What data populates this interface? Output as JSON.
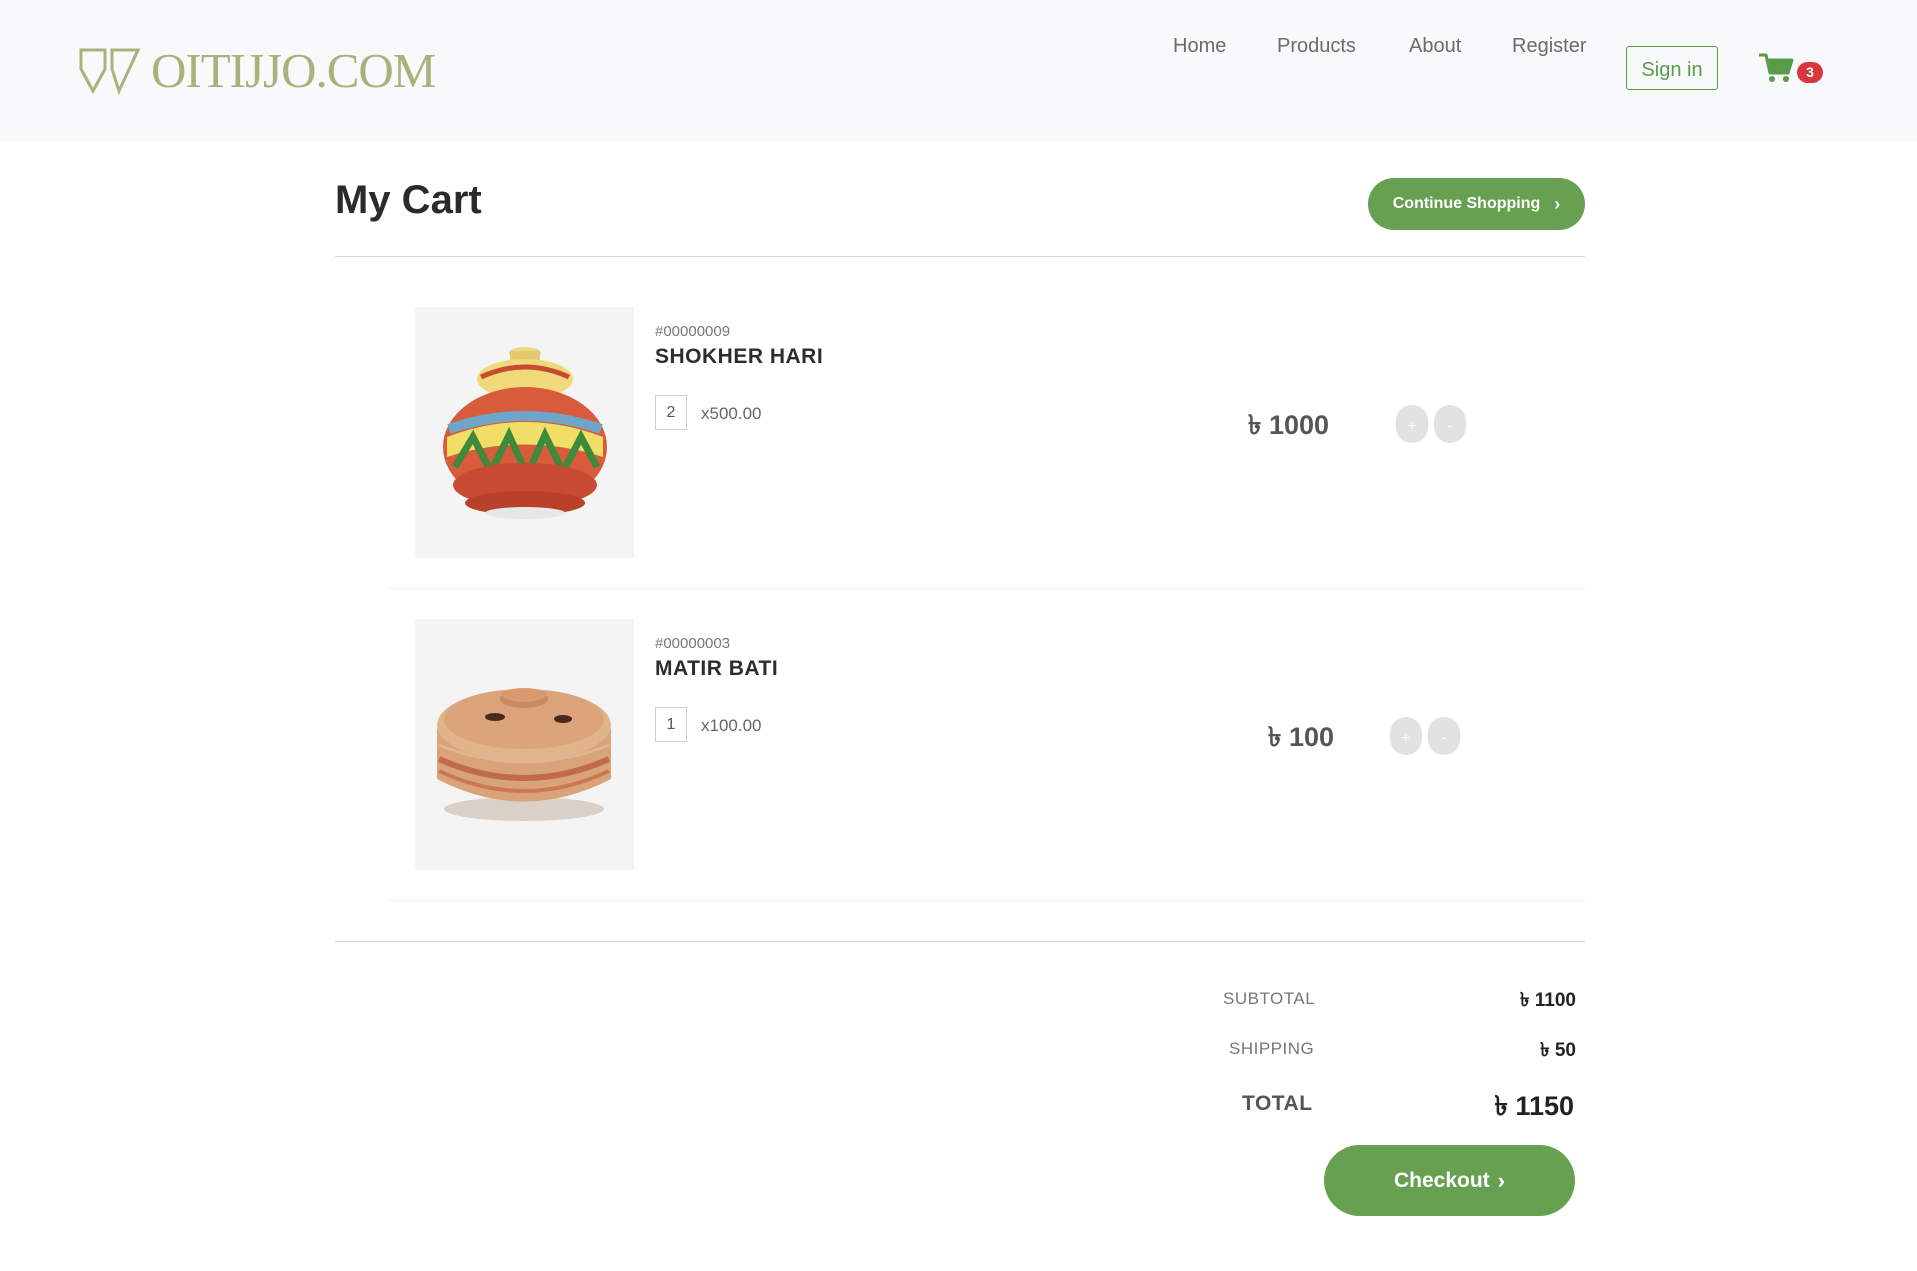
{
  "brand": {
    "name": "OITIJJO.COM",
    "logo_icon": "shield-mark-icon"
  },
  "nav": {
    "links": [
      "Home",
      "Products",
      "About",
      "Register"
    ],
    "signin_label": "Sign in",
    "cart_icon": "cart-icon",
    "cart_count": "3"
  },
  "cart": {
    "title": "My Cart",
    "continue_label": "Continue Shopping",
    "items": [
      {
        "sku": "#00000009",
        "name": "SHOKHER HARI",
        "qty": "2",
        "unit_price": "x500.00",
        "line_total": "৳ 1000",
        "plus_label": "+",
        "minus_label": "-",
        "image": "painted-clay-pot-image"
      },
      {
        "sku": "#00000003",
        "name": "MATIR BATI",
        "qty": "1",
        "unit_price": "x100.00",
        "line_total": "৳ 100",
        "plus_label": "+",
        "minus_label": "-",
        "image": "clay-bowl-with-lid-image"
      }
    ]
  },
  "summary": {
    "subtotal_label": "SUBTOTAL",
    "subtotal_value": "৳ 1100",
    "shipping_label": "SHIPPING",
    "shipping_value": "৳ 50",
    "total_label": "TOTAL",
    "total_value": "৳ 1150",
    "checkout_label": "Checkout"
  },
  "colors": {
    "accent_green": "#67a050",
    "brand_olive": "#a9b27a",
    "badge_red": "#d9363e",
    "header_bg": "#f8f9fa"
  }
}
